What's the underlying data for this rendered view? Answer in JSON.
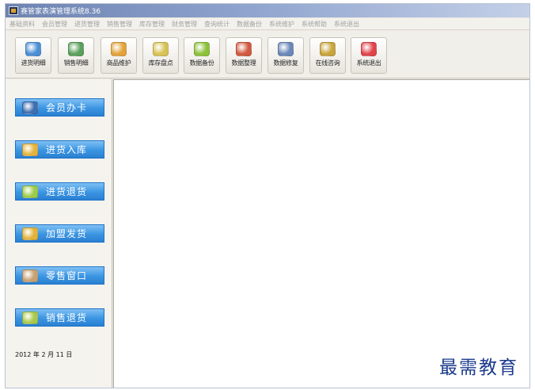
{
  "window": {
    "title": "赛管家表演管理系统8.36"
  },
  "menu": [
    "基础资料",
    "会员管理",
    "进货管理",
    "销售管理",
    "库存管理",
    "财务管理",
    "查询统计",
    "数据备份",
    "系统维护",
    "系统帮助",
    "系统退出"
  ],
  "toolbar": [
    {
      "label": "进货明细",
      "icon": "brush-icon",
      "color": "#4a8fd6"
    },
    {
      "label": "销售明细",
      "icon": "gift-icon",
      "color": "#5aa05a"
    },
    {
      "label": "商品维护",
      "icon": "box-icon",
      "color": "#e3a23a"
    },
    {
      "label": "库存盘点",
      "icon": "stack-icon",
      "color": "#d7c254"
    },
    {
      "label": "数据备份",
      "icon": "disc-icon",
      "color": "#8cc13a"
    },
    {
      "label": "数据整理",
      "icon": "chart-icon",
      "color": "#d0593f"
    },
    {
      "label": "数据修复",
      "icon": "folder-icon",
      "color": "#6a88b8"
    },
    {
      "label": "在线咨询",
      "icon": "notepad-icon",
      "color": "#c9a43c"
    },
    {
      "label": "系统退出",
      "icon": "power-icon",
      "color": "#e0444a"
    }
  ],
  "sidebar": [
    {
      "label": "会员办卡",
      "icon": "member-icon",
      "color": "#3f6fb0"
    },
    {
      "label": "进货入库",
      "icon": "folder-in-icon",
      "color": "#e4b33c"
    },
    {
      "label": "进货退货",
      "icon": "return-icon",
      "color": "#9ccb4a"
    },
    {
      "label": "加盟发货",
      "icon": "shipment-icon",
      "color": "#e2b339"
    },
    {
      "label": "零售窗口",
      "icon": "store-icon",
      "color": "#c7a172"
    },
    {
      "label": "销售退货",
      "icon": "cash-icon",
      "color": "#a8c94a"
    }
  ],
  "date": {
    "text": "2012 年   2 月 11  日"
  },
  "watermark": "最需教育"
}
